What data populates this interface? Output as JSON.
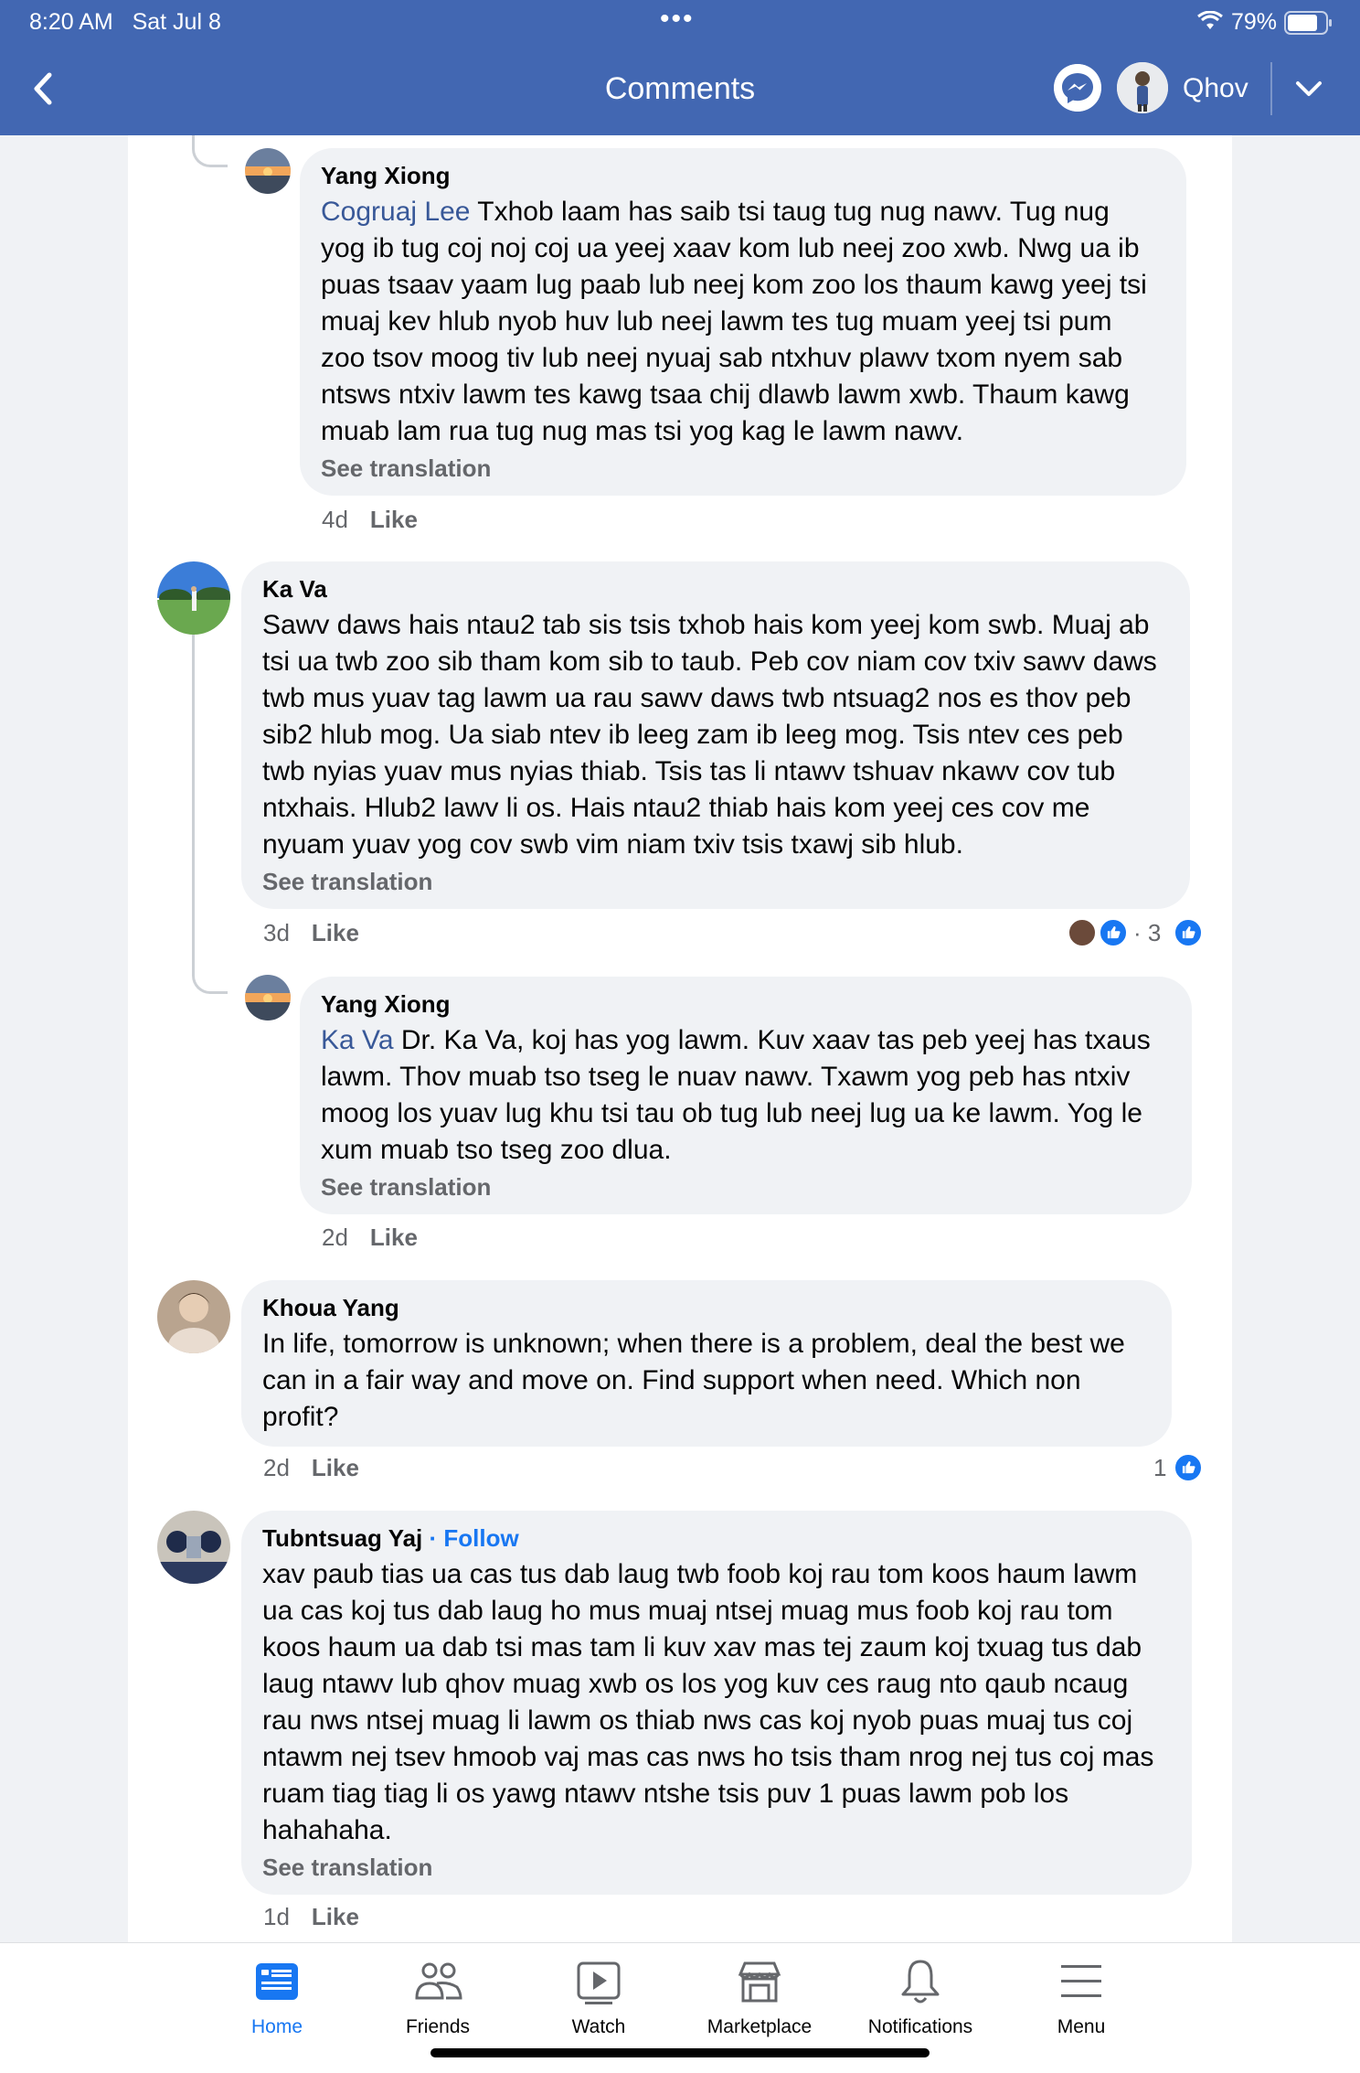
{
  "status_bar": {
    "time": "8:20 AM",
    "date": "Sat Jul 8",
    "dots": "•••",
    "battery": "79%"
  },
  "header": {
    "title": "Comments",
    "profile_name": "Qhov"
  },
  "colors": {
    "header_bg": "#4267b2",
    "accent": "#1877f2",
    "bubble_bg": "#f0f2f5",
    "mention": "#385898"
  },
  "comments": [
    {
      "author": "Yang Xiong",
      "mention": "Cogruaj Lee",
      "lines": [
        " Txhob laam has saib tsi taug tug nug nawv.  Tug nug",
        "yog ib tug coj noj coj ua yeej xaav kom lub neej zoo xwb.  Nwg ua ib",
        "puas tsaav yaam lug paab lub neej kom zoo los thaum kawg yeej tsi",
        "muaj kev hlub nyob huv lub neej lawm tes tug muam yeej tsi pum",
        "zoo tsov moog tiv lub neej nyuaj sab ntxhuv plawv txom nyem sab",
        "ntsws ntxiv lawm tes kawg tsaa chij dlawb lawm xwb.  Thaum kawg",
        "muab lam rua tug nug mas tsi yog kag le lawm nawv."
      ],
      "see_translation": "See translation",
      "time": "4d",
      "like": "Like"
    },
    {
      "author": "Ka Va",
      "lines": [
        "Sawv daws hais ntau2 tab sis tsis txhob hais kom yeej kom swb. Muaj ab",
        "tsi ua twb zoo sib tham kom sib to taub. Peb cov niam cov txiv sawv daws",
        "twb mus yuav tag lawm ua rau sawv daws twb ntsuag2 nos es thov peb",
        "sib2 hlub mog. Ua siab ntev ib leeg zam ib leeg mog. Tsis ntev ces peb",
        "twb nyias yuav mus nyias thiab. Tsis tas li ntawv tshuav nkawv cov tub",
        "ntxhais. Hlub2 lawv li os. Hais ntau2 thiab hais kom yeej ces cov me",
        "nyuam yuav yog cov swb vim niam txiv tsis txawj sib hlub."
      ],
      "see_translation": "See translation",
      "time": "3d",
      "like": "Like",
      "reactions": "· 3"
    },
    {
      "author": "Yang Xiong",
      "mention": "Ka Va",
      "lines": [
        " Dr. Ka Va, koj has yog lawm.  Kuv xaav tas peb yeej has txaus",
        "lawm.  Thov muab tso tseg le nuav nawv.  Txawm yog peb has ntxiv",
        "moog los yuav lug khu tsi tau ob tug lub neej lug ua ke lawm.  Yog le",
        "xum muab tso tseg zoo dlua."
      ],
      "see_translation": "See translation",
      "time": "2d",
      "like": "Like"
    },
    {
      "author": "Khoua Yang",
      "lines": [
        "In life, tomorrow is unknown; when there is a problem, deal the best we",
        "can in a fair way and move on. Find support when need. Which non",
        "profit?"
      ],
      "time": "2d",
      "like": "Like",
      "reactions": "1"
    },
    {
      "author": "Tubntsuag Yaj",
      "follow": "· Follow",
      "lines": [
        "xav paub tias ua cas tus dab laug twb foob koj rau tom koos haum lawm",
        "ua cas koj tus dab laug ho mus muaj ntsej muag mus foob koj rau tom",
        "koos haum ua dab tsi mas tam li kuv xav mas tej zaum koj txuag tus dab",
        "laug ntawv lub qhov muag xwb os los yog kuv ces raug nto qaub ncaug",
        "rau nws ntsej muag li lawm os thiab nws cas koj nyob puas muaj tus coj",
        "ntawm nej tsev hmoob vaj mas cas nws ho tsis tham nrog nej tus coj mas",
        "ruam tiag tiag li os yawg ntawv ntshe tsis puv 1 puas lawm pob los",
        "hahahaha."
      ],
      "see_translation": "See translation",
      "time": "1d",
      "like": "Like"
    }
  ],
  "tabbar": {
    "home": "Home",
    "friends": "Friends",
    "watch": "Watch",
    "marketplace": "Marketplace",
    "notifications": "Notifications",
    "menu": "Menu"
  }
}
